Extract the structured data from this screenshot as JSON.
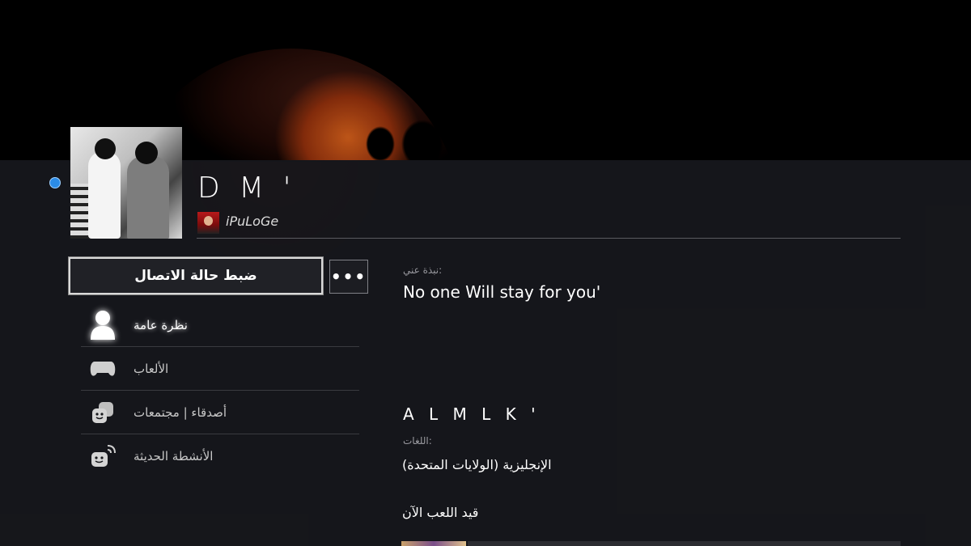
{
  "profile": {
    "online_id": "D M '",
    "real_name": "iPuLoGe",
    "status_color": "#2b8be6"
  },
  "actions": {
    "set_status_label": "ضبط حالة الاتصال",
    "more_label": "•••"
  },
  "menu": [
    {
      "label": "نظرة عامة",
      "icon": "person-icon",
      "active": true
    },
    {
      "label": "الألعاب",
      "icon": "gamepad-icon",
      "active": false
    },
    {
      "label": "أصدقاء  |  مجتمعات",
      "icon": "friends-communities-icon",
      "active": false
    },
    {
      "label": "الأنشطة الحديثة",
      "icon": "recent-activity-icon",
      "active": false
    }
  ],
  "details": {
    "about_label": "نبذة عني:",
    "about_text": "No one Will stay for you'",
    "alias": "A L M L K '",
    "languages_label": "اللغات:",
    "languages_value": "الإنجليزية (الولايات المتحدة)",
    "now_playing_label": "قيد اللعب الآن"
  },
  "colors": {
    "background": "#16171b",
    "accent_online": "#2b8be6"
  }
}
